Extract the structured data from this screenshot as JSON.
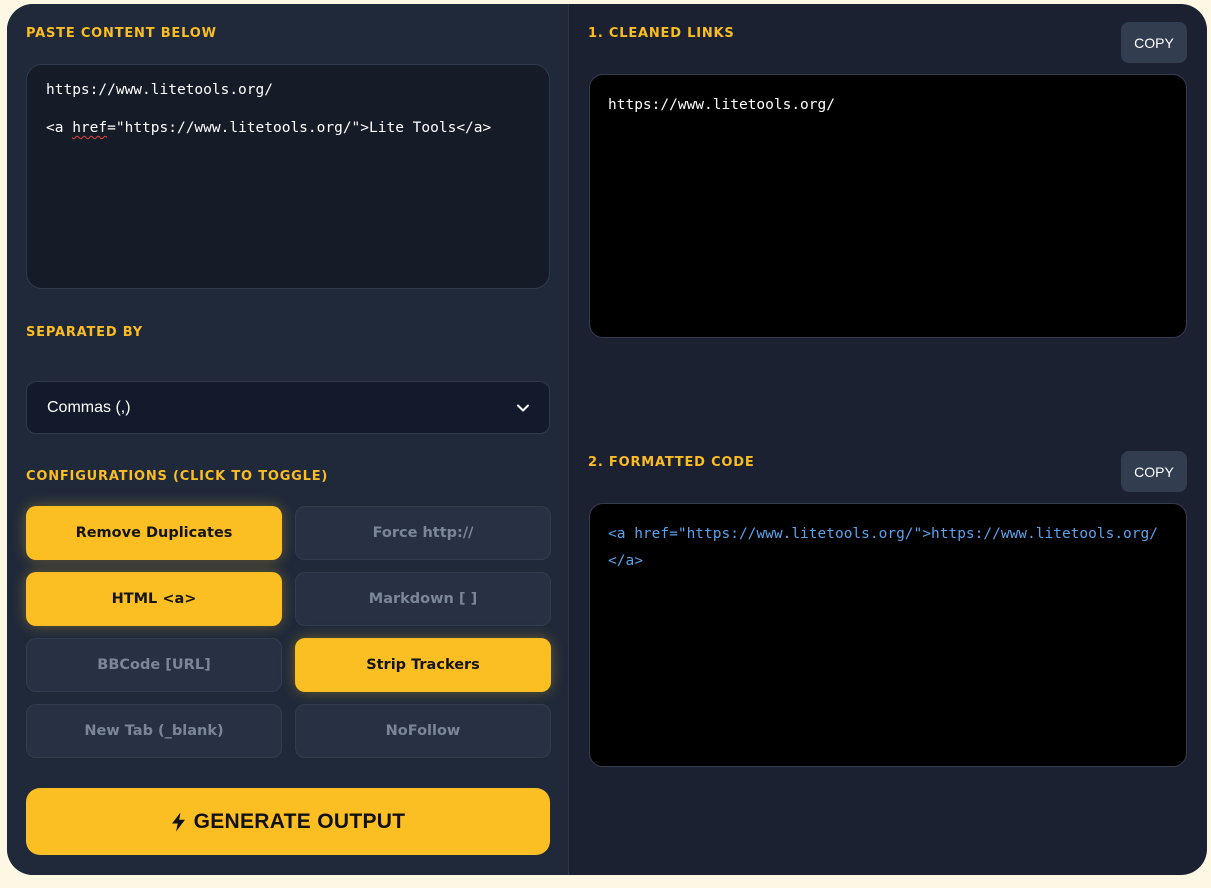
{
  "input": {
    "label": "PASTE CONTENT BELOW",
    "lines": [
      "https://www.litetools.org/",
      "<a href=\"https://www.litetools.org/\">Lite Tools</a>"
    ],
    "line2_parts": [
      "<a ",
      "href",
      "=\"https://www.litetools.org/\">Lite Tools</a>"
    ]
  },
  "separator": {
    "label": "SEPARATED BY",
    "selected": "Commas (,)",
    "icon": "chevron-down-icon"
  },
  "configurations": {
    "label": "CONFIGURATIONS (CLICK TO TOGGLE)",
    "options": [
      {
        "label": "Remove Duplicates",
        "active": true
      },
      {
        "label": "Force http://",
        "active": false
      },
      {
        "label": "HTML <a>",
        "active": true
      },
      {
        "label": "Markdown [ ]",
        "active": false
      },
      {
        "label": "BBCode [URL]",
        "active": false
      },
      {
        "label": "Strip Trackers",
        "active": true
      },
      {
        "label": "New Tab (_blank)",
        "active": false
      },
      {
        "label": "NoFollow",
        "active": false
      }
    ]
  },
  "generate": {
    "label": "GENERATE OUTPUT",
    "icon": "lightning-bolt-icon"
  },
  "cleaned_links": {
    "label": "1. CLEANED LINKS",
    "copy_label": "COPY",
    "content": "https://www.litetools.org/"
  },
  "formatted_code": {
    "label": "2. FORMATTED CODE",
    "copy_label": "COPY",
    "content": "<a href=\"https://www.litetools.org/\">https://www.litetools.org/</a>"
  },
  "colors": {
    "accent": "#fbbf24",
    "panel_left": "#1f293a",
    "panel_right": "#1b2131",
    "code_text": "#5aa2ec"
  }
}
